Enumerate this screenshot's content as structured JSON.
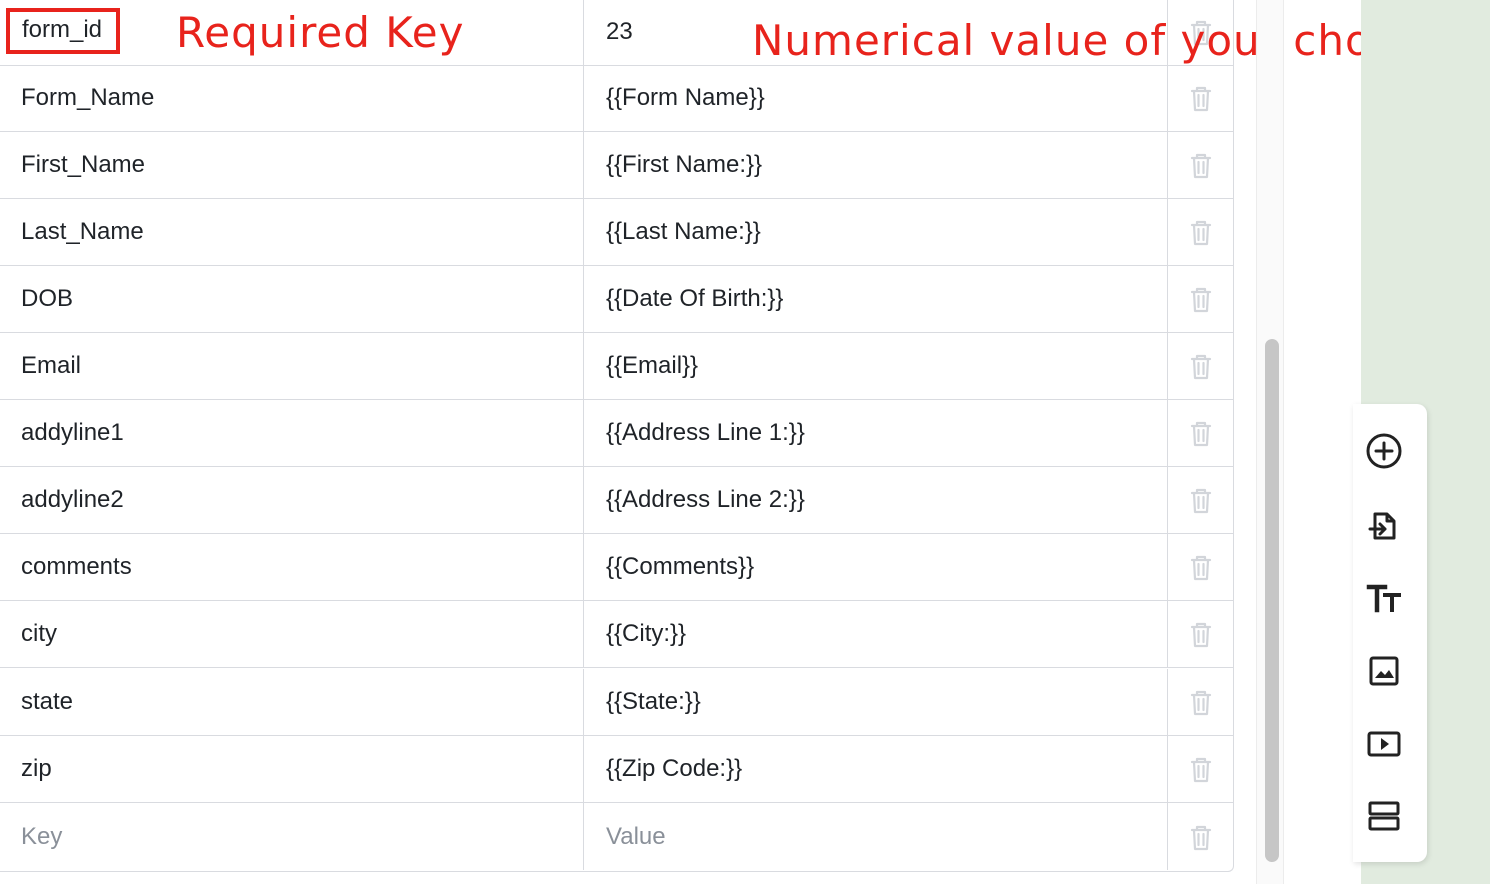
{
  "annotations": {
    "required_key": "Required Key",
    "numerical_value": "Numerical value of your choosing"
  },
  "rows": [
    {
      "key": "form_id",
      "value": "23"
    },
    {
      "key": "Form_Name",
      "value": "{{Form Name}}"
    },
    {
      "key": "First_Name",
      "value": "{{First Name:}}"
    },
    {
      "key": "Last_Name",
      "value": "{{Last Name:}}"
    },
    {
      "key": "DOB",
      "value": "{{Date Of Birth:}}"
    },
    {
      "key": "Email",
      "value": "{{Email}}"
    },
    {
      "key": "addyline1",
      "value": "{{Address Line 1:}}"
    },
    {
      "key": "addyline2",
      "value": "{{Address Line 2:}}"
    },
    {
      "key": "comments",
      "value": "{{Comments}}"
    },
    {
      "key": "city",
      "value": "{{City:}}"
    },
    {
      "key": "state",
      "value": "{{State:}}"
    },
    {
      "key": "zip",
      "value": "{{Zip Code:}}"
    }
  ],
  "new_row": {
    "key_placeholder": "Key",
    "value_placeholder": "Value"
  },
  "row_action_icon": "trash-icon",
  "toolbar": {
    "items": [
      "add-circle-icon",
      "import-file-icon",
      "text-icon",
      "image-icon",
      "video-icon",
      "layout-rows-icon"
    ]
  },
  "colors": {
    "annotation_red": "#e8231c",
    "canvas_green": "#e1ebdf",
    "border": "#d9dbe0",
    "placeholder": "#8a9099"
  }
}
